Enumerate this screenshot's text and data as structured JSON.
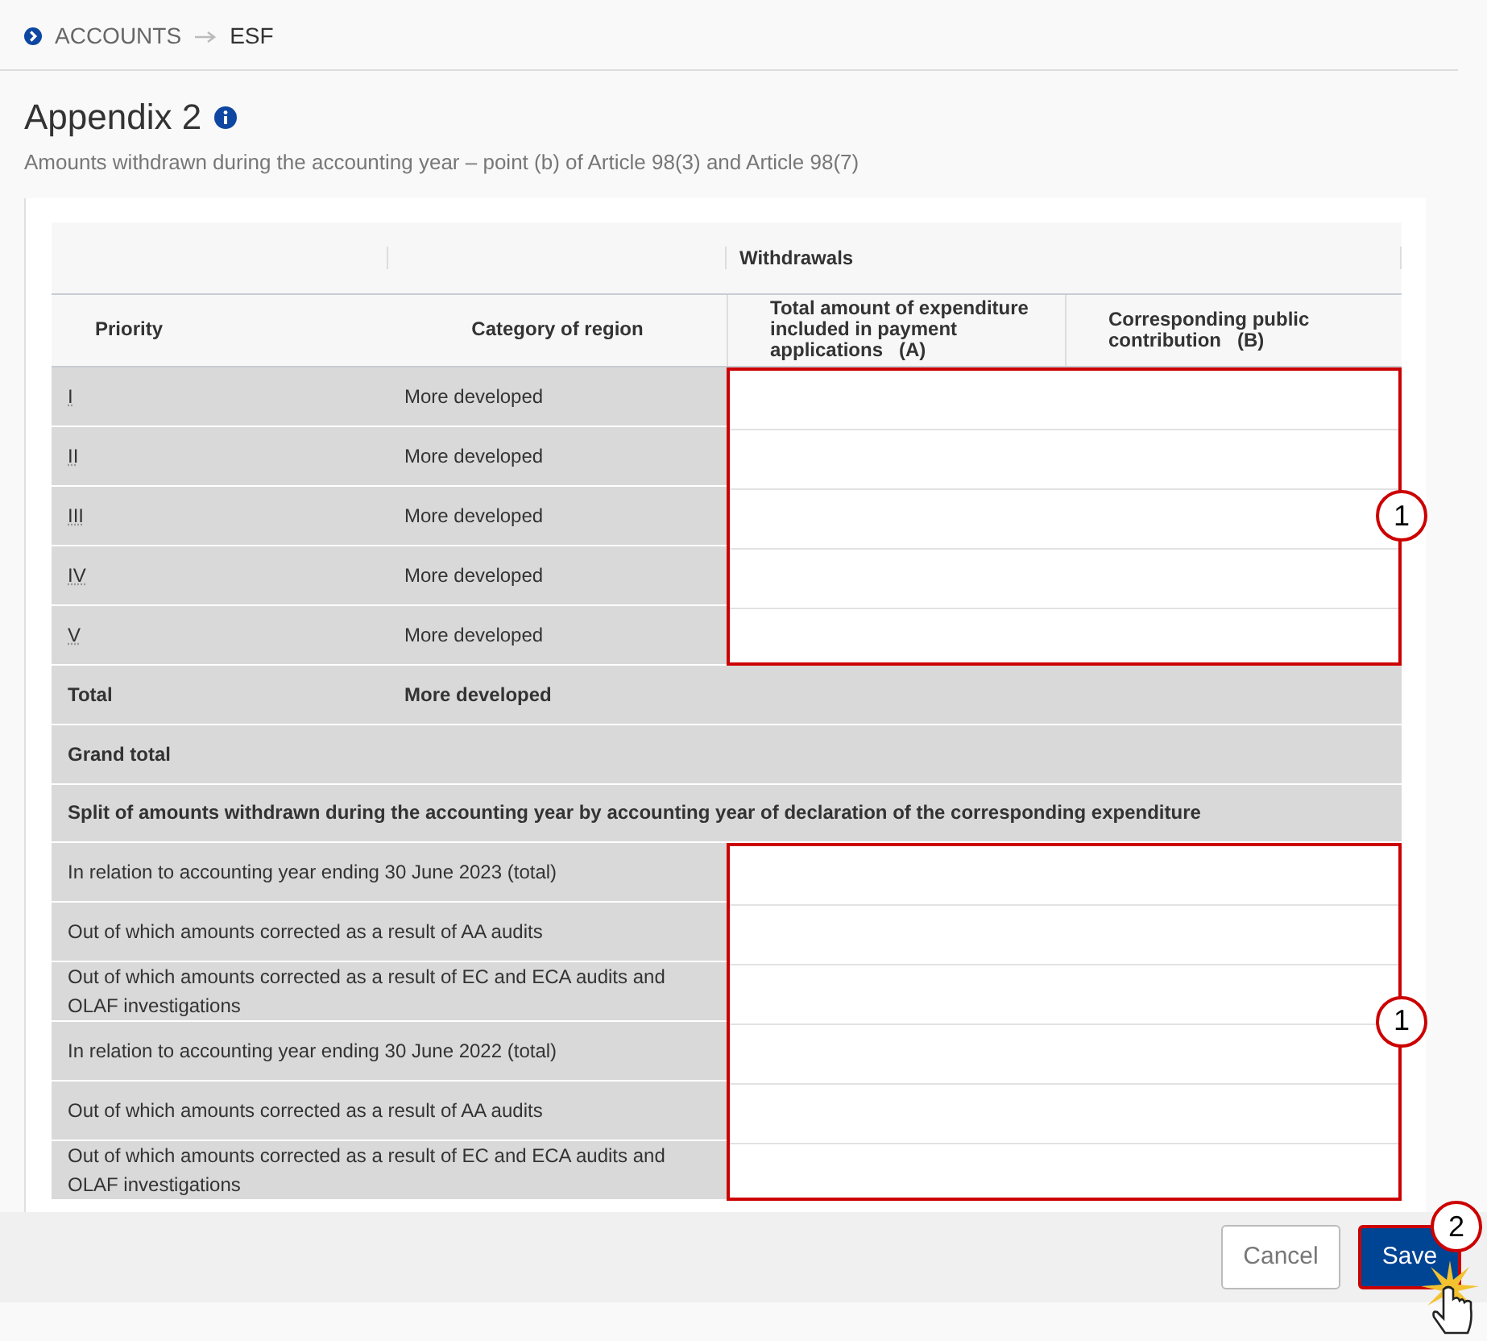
{
  "breadcrumb": [
    {
      "text": "ACCOUNTS"
    },
    {
      "text": "ESF"
    }
  ],
  "title": "Appendix 2",
  "subtitle": "Amounts withdrawn during the accounting year – point (b) of Article 98(3) and Article 98(7)",
  "table": {
    "group_header": "Withdrawals",
    "columns": [
      "Priority",
      "Category of region",
      "Total amount of expenditure included in payment applications   (A)",
      "Corresponding public contribution   (B)"
    ],
    "rows": [
      {
        "priority": "I",
        "category": "More developed"
      },
      {
        "priority": "II",
        "category": "More developed"
      },
      {
        "priority": "III",
        "category": "More developed"
      },
      {
        "priority": "IV",
        "category": "More developed"
      },
      {
        "priority": "V",
        "category": "More developed"
      }
    ],
    "callout_rows": "1",
    "total": {
      "label": "Total",
      "category": "More developed"
    },
    "grand_total": {
      "label": "Grand total"
    },
    "split_heading": "Split of amounts withdrawn during the accounting year by accounting year of declaration of the corresponding expenditure",
    "split_rows": [
      {
        "label": "In relation to accounting year ending 30 June 2023 (total)"
      },
      {
        "label": "Out of which amounts corrected as a result of AA audits"
      },
      {
        "label": "Out of which amounts corrected as a result of EC and ECA audits and OLAF investigations"
      },
      {
        "label": "In relation to accounting year ending 30 June 2022 (total)"
      },
      {
        "label": "Out of which amounts corrected as a result of AA audits"
      },
      {
        "label": "Out of which amounts corrected as a result of EC and ECA audits and OLAF investigations"
      }
    ],
    "callout_split": "1"
  },
  "buttons": [
    {
      "label": "Cancel",
      "kind": "secondary"
    },
    {
      "label": "Save",
      "kind": "primary"
    }
  ],
  "callout_save": "2"
}
